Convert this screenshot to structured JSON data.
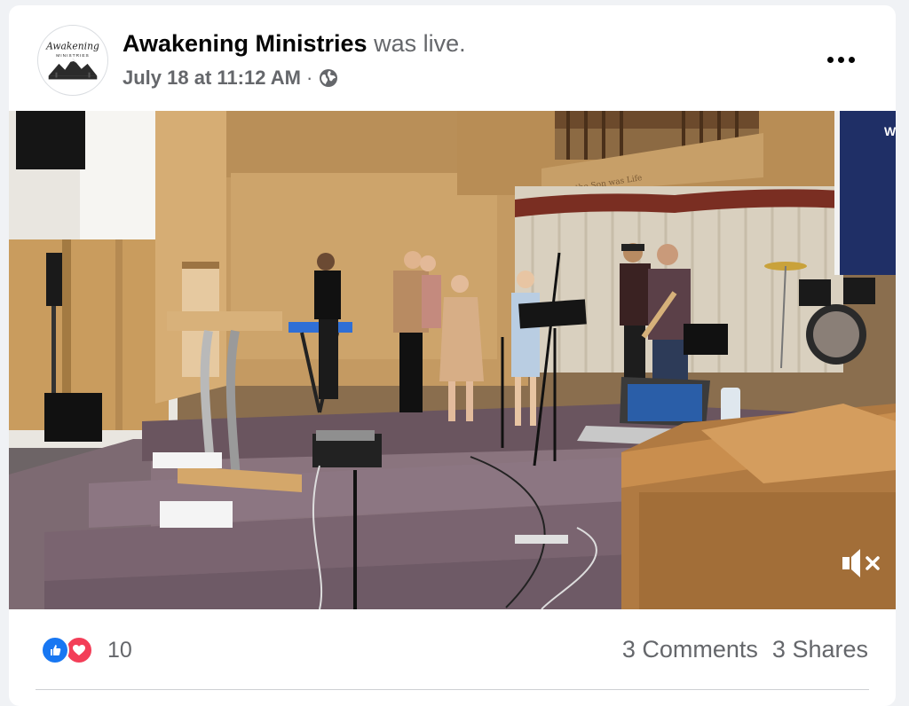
{
  "post": {
    "page_name": "Awakening Ministries",
    "action": "was live.",
    "timestamp": "July 18 at 11:12 AM",
    "separator": "·",
    "privacy_icon": "globe-icon",
    "more_icon": "more-options-icon"
  },
  "avatar": {
    "logo_title": "Awakening",
    "logo_subtitle": "MINISTRIES"
  },
  "video": {
    "banner_text": "Was the Son was Life",
    "screen_text": "W",
    "mute_icon": "muted-speaker-icon"
  },
  "footer": {
    "reaction_count": "10",
    "comments": "3 Comments",
    "shares": "3 Shares"
  },
  "colors": {
    "facebook_blue": "#1877f2",
    "love_red": "#f33e58",
    "secondary_text": "#65676b"
  }
}
